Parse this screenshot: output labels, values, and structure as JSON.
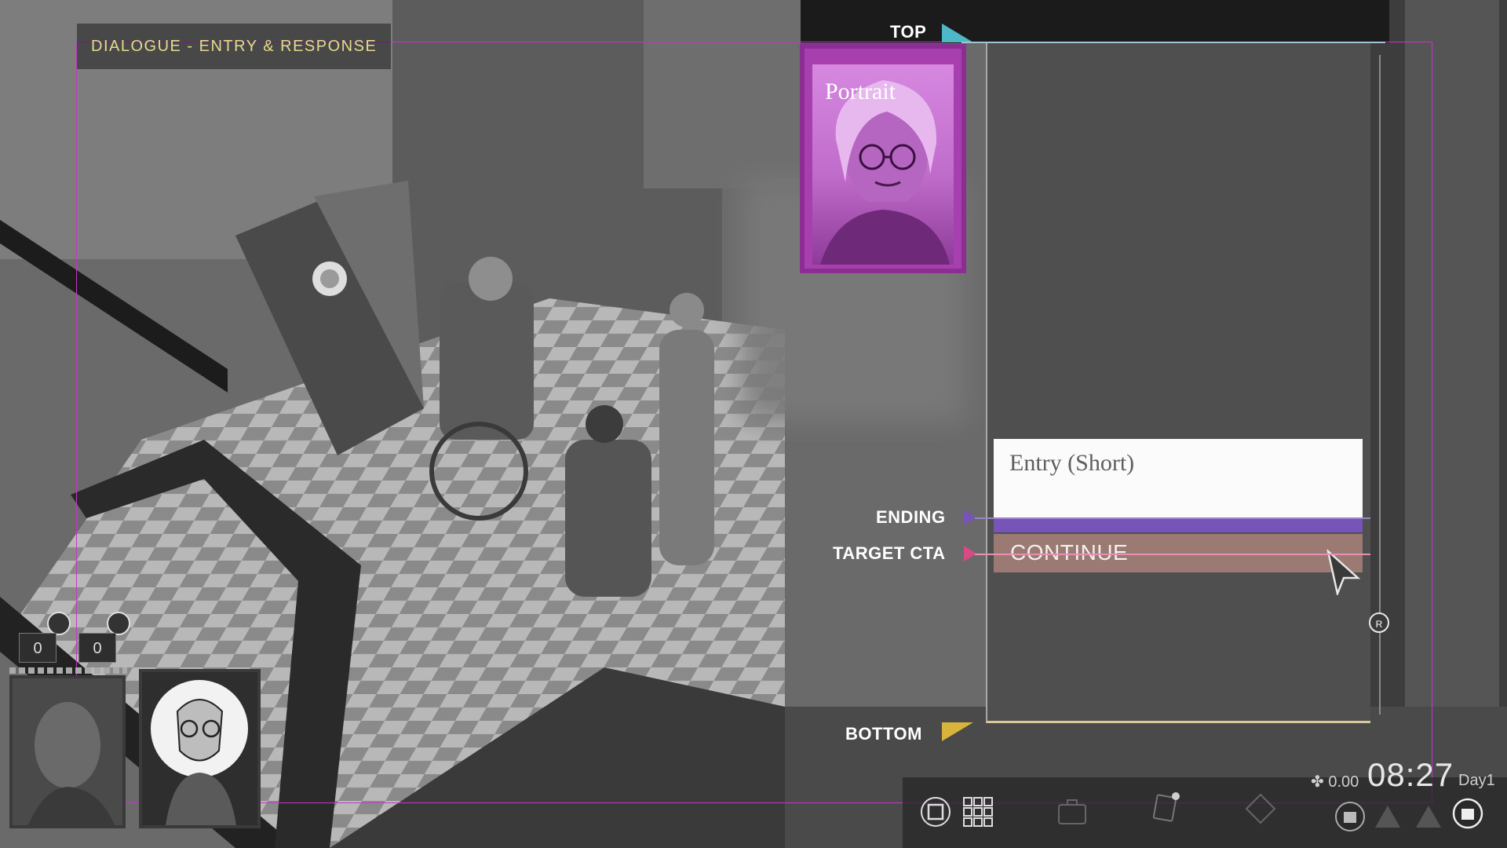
{
  "section_label": "DIALOGUE - ENTRY & RESPONSE",
  "portrait": {
    "title": "Portrait"
  },
  "dialogue": {
    "entry_text": "Entry (Short)",
    "continue_label": "CONTINUE"
  },
  "markers": {
    "top": "TOP",
    "ending": "ENDING",
    "target_cta": "TARGET CTA",
    "bottom": "BOTTOM"
  },
  "scroll_button_label": "R",
  "hud": {
    "money": "0.00",
    "time": "08:27",
    "day": "Day1",
    "icons": [
      "single-view-icon",
      "grid-view-icon",
      "briefcase-icon",
      "journal-icon",
      "map-icon",
      "character-1-icon",
      "character-2-icon",
      "character-3-icon",
      "character-4-icon"
    ]
  },
  "party": {
    "counters": [
      "0",
      "0"
    ]
  },
  "colors": {
    "guide_frame": "#c238c9",
    "top_marker": "#4fb8c8",
    "ending_marker": "#7654b8",
    "target_cta_marker": "#d84a84",
    "bottom_marker": "#d8b43c",
    "portrait_tint": "#a83fae"
  }
}
